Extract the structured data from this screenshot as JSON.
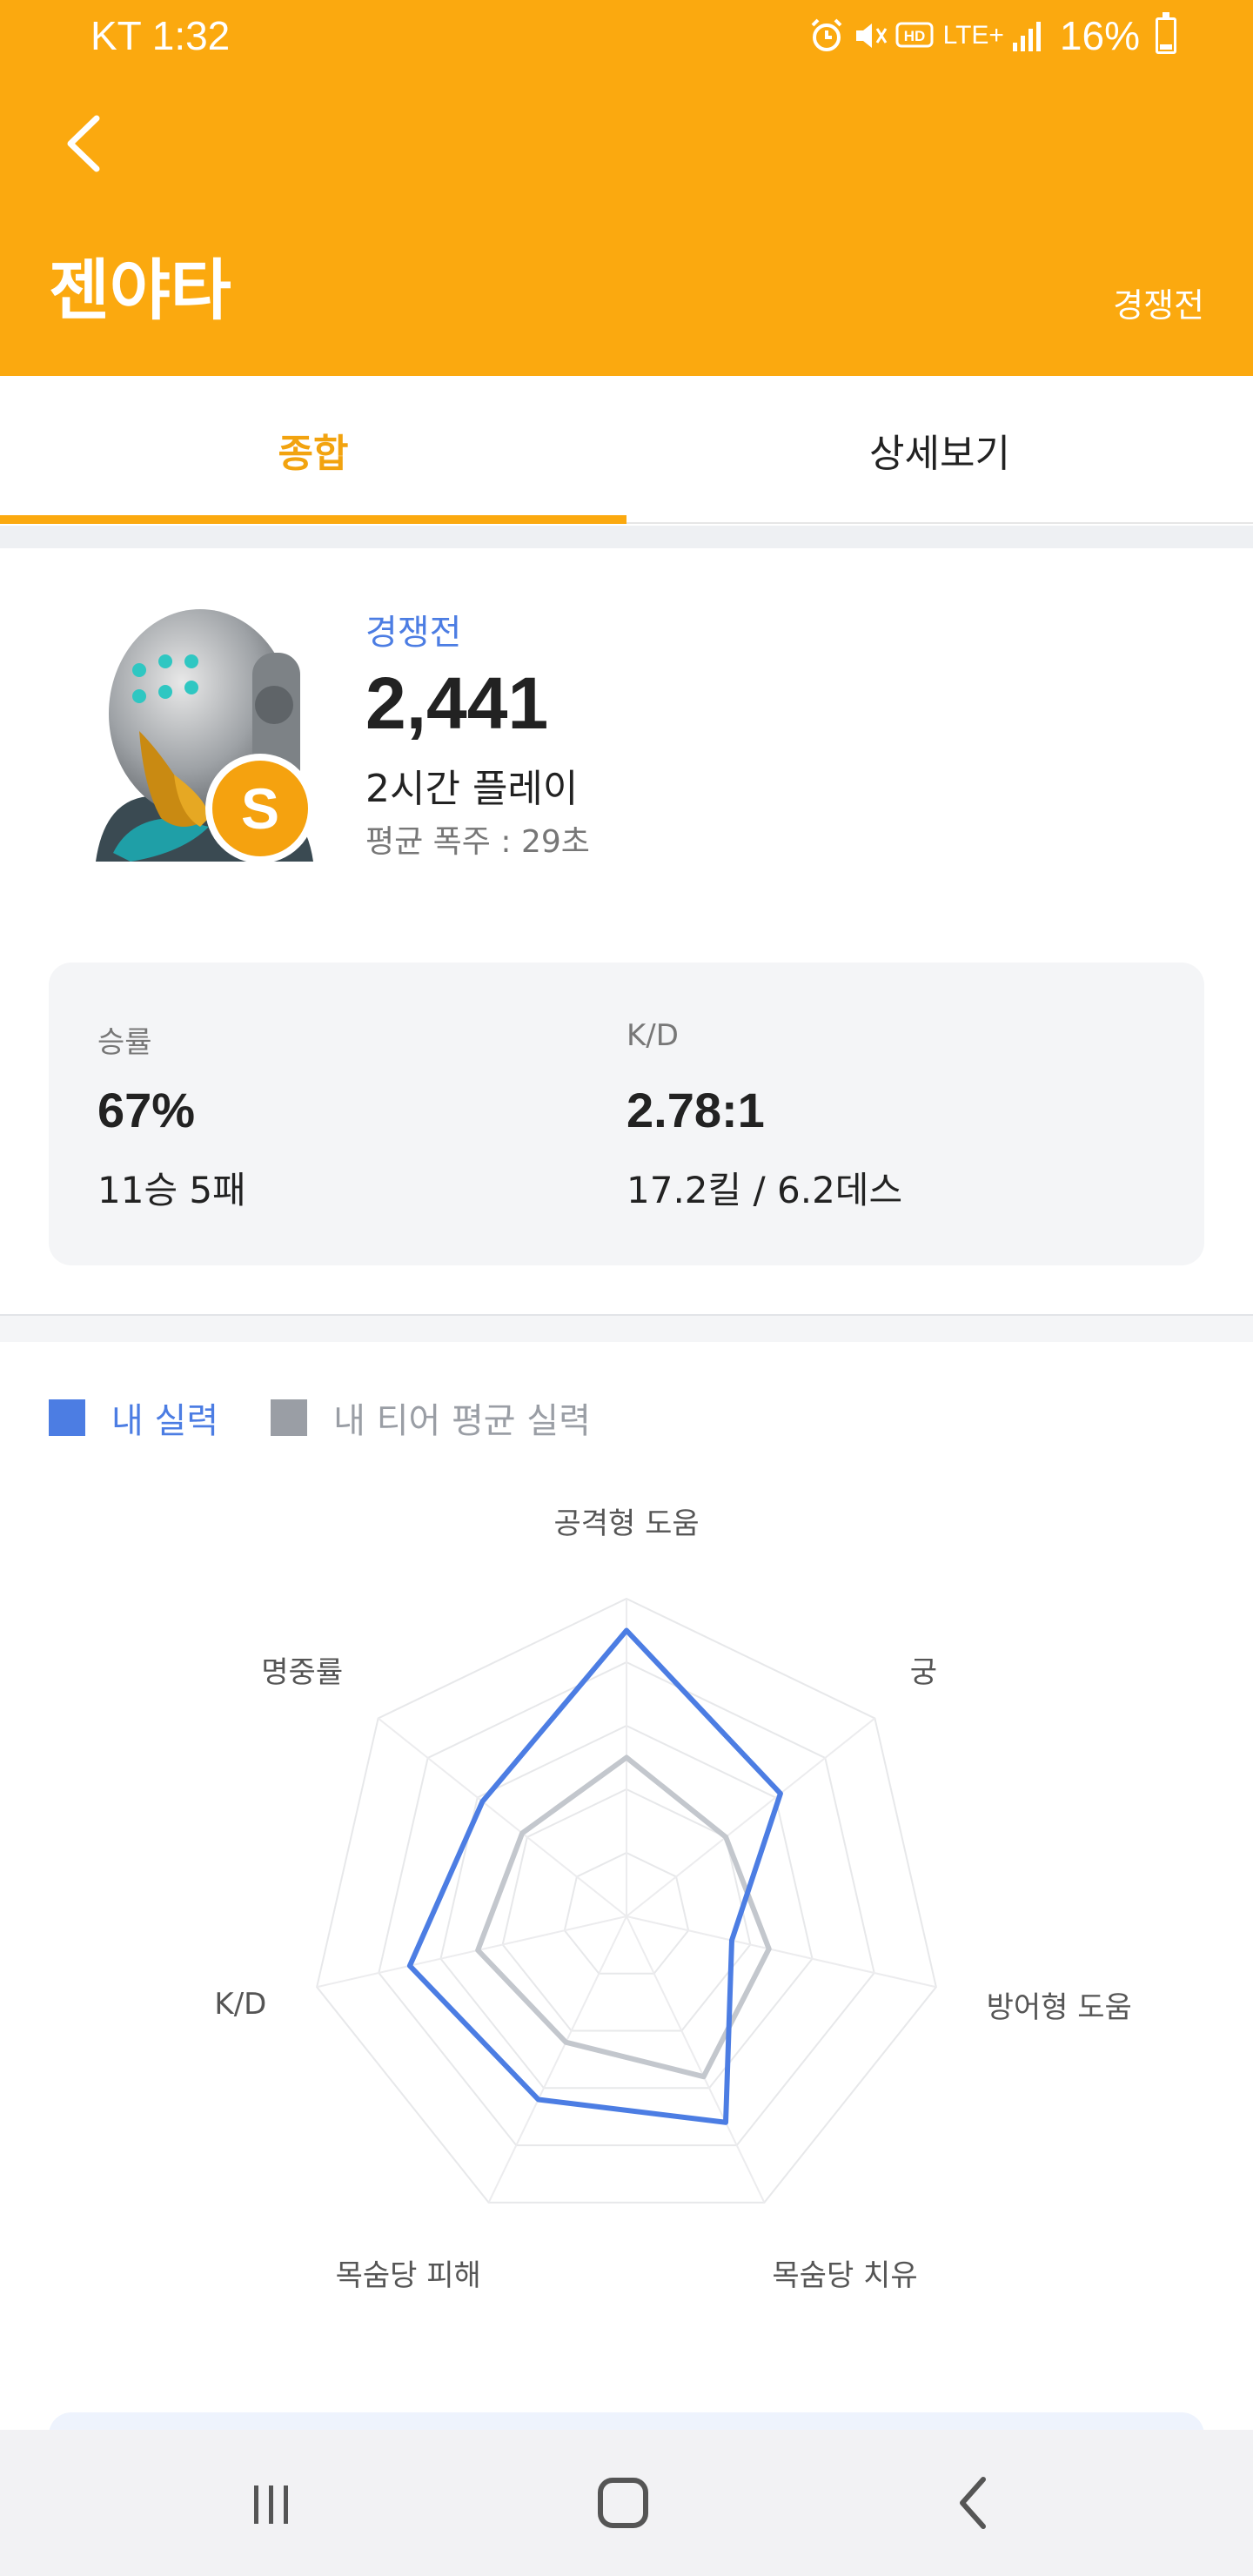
{
  "status_bar": {
    "carrier_time": "KT 1:32",
    "battery": "16%",
    "network": "LTE+"
  },
  "header": {
    "title": "젠야타",
    "mode": "경쟁전"
  },
  "tabs": [
    {
      "label": "종합",
      "active": true
    },
    {
      "label": "상세보기",
      "active": false
    }
  ],
  "profile": {
    "rank_badge": "S",
    "mode_title": "경쟁전",
    "sr": "2,441",
    "playtime": "2시간 플레이",
    "avg_on_fire": "평균 폭주 : 29초"
  },
  "stats": {
    "winrate_label": "승률",
    "winrate": "67%",
    "record": "11승 5패",
    "kd_label": "K/D",
    "kd": "2.78:1",
    "kd_detail": "17.2킬 / 6.2데스"
  },
  "legend": {
    "mine": "내 실력",
    "tier_avg": "내 티어 평균 실력",
    "mine_color": "#4C7DE3",
    "tier_color": "#9A9EA5"
  },
  "chart_data": {
    "type": "radar",
    "axes": [
      "공격형 도움",
      "궁",
      "방어형 도움",
      "목숨당 치유",
      "목숨당 피해",
      "K/D",
      "명중률"
    ],
    "max": 5,
    "series": [
      {
        "name": "내 실력",
        "values": [
          4.5,
          3.1,
          1.7,
          3.6,
          3.2,
          3.5,
          2.9
        ],
        "color": "#4C7DE3"
      },
      {
        "name": "내 티어 평균 실력",
        "values": [
          2.5,
          2.0,
          2.3,
          2.8,
          2.2,
          2.4,
          2.1
        ],
        "color": "#C3C7CD"
      }
    ]
  }
}
